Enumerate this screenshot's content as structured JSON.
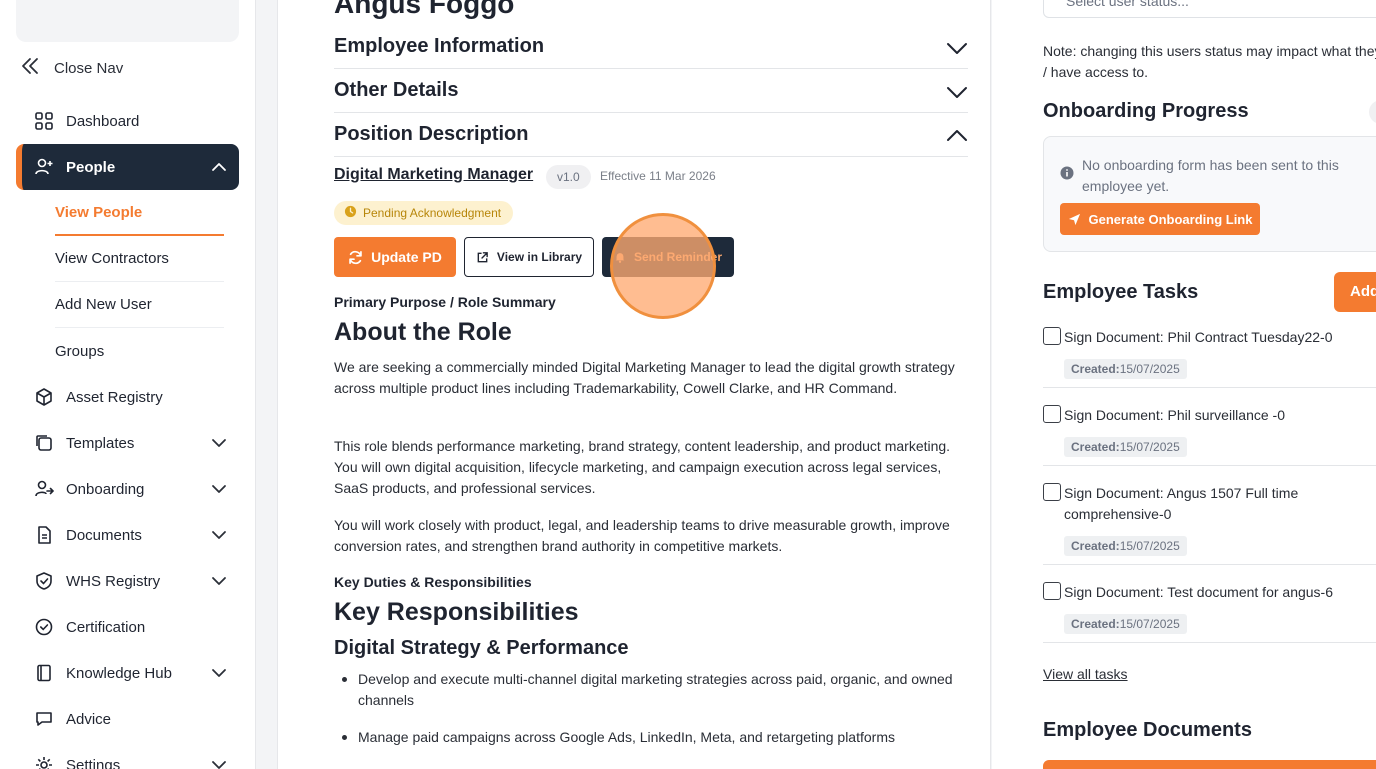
{
  "sidebar": {
    "close_nav": "Close Nav",
    "items": [
      {
        "label": "Dashboard"
      },
      {
        "label": "People"
      },
      {
        "label": "Asset Registry"
      },
      {
        "label": "Templates"
      },
      {
        "label": "Onboarding"
      },
      {
        "label": "Documents"
      },
      {
        "label": "WHS Registry"
      },
      {
        "label": "Certification"
      },
      {
        "label": "Knowledge Hub"
      },
      {
        "label": "Advice"
      },
      {
        "label": "Settings"
      }
    ],
    "people_sub": [
      {
        "label": "View People"
      },
      {
        "label": "View Contractors"
      },
      {
        "label": "Add New User"
      },
      {
        "label": "Groups"
      }
    ]
  },
  "main": {
    "employee_name": "Angus Foggo",
    "sections": [
      {
        "label": "Employee Information"
      },
      {
        "label": "Other Details"
      },
      {
        "label": "Position Description"
      }
    ],
    "position": {
      "title": "Digital Marketing Manager",
      "version": "v1.0",
      "effective": "Effective 11 Mar 2026",
      "status": "Pending Acknowledgment"
    },
    "actions": {
      "update": "Update PD",
      "library": "View in Library",
      "reminder": "Send Reminder"
    },
    "content": {
      "purpose_label": "Primary Purpose / Role Summary",
      "about_heading": "About the Role",
      "paragraphs": [
        "We are seeking a commercially minded Digital Marketing Manager to lead the digital growth strategy across multiple product lines including Trademarkability, Cowell Clarke, and HR Command.",
        "This role blends performance marketing, brand strategy, content leadership, and product marketing. You will own digital acquisition, lifecycle marketing, and campaign execution across legal services, SaaS products, and professional services.",
        "You will work closely with product, legal, and leadership teams to drive measurable growth, improve conversion rates, and strengthen brand authority in competitive markets."
      ],
      "duties_label": "Key Duties & Responsibilities",
      "responsibilities_heading": "Key Responsibilities",
      "sub_heading": "Digital Strategy & Performance",
      "bullets": [
        "Develop and execute multi-channel digital marketing strategies across paid, organic, and owned channels",
        "Manage paid campaigns across Google Ads, LinkedIn, Meta, and retargeting platforms"
      ]
    }
  },
  "right": {
    "status_placeholder": "Select user status...",
    "note": "Note: changing this users status may impact what they\n/ have access to.",
    "onboarding": {
      "title": "Onboarding Progress",
      "message": "No onboarding form has been sent to this employee yet.",
      "button": "Generate Onboarding Link"
    },
    "tasks": {
      "title": "Employee Tasks",
      "add_label": "Add",
      "created_label": "Created:",
      "items": [
        {
          "label": "Sign Document: Phil Contract Tuesday22-0",
          "date": "15/07/2025"
        },
        {
          "label": "Sign Document: Phil surveillance -0",
          "date": "15/07/2025"
        },
        {
          "label": "Sign Document: Angus 1507 Full time comprehensive-0",
          "date": "15/07/2025"
        },
        {
          "label": "Sign Document: Test document for angus-6",
          "date": "15/07/2025"
        }
      ],
      "view_all": "View all tasks"
    },
    "documents": {
      "title": "Employee Documents"
    }
  },
  "colors": {
    "accent": "#f47b30",
    "nav_active": "#1e2a3a",
    "pending_bg": "#fdf1cf",
    "pending_text": "#b7860a"
  }
}
